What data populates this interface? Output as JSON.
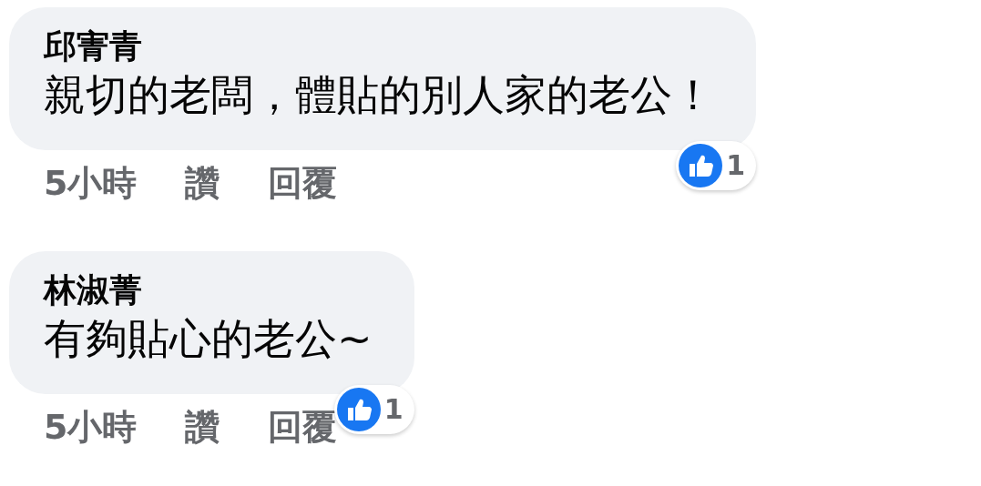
{
  "comments": [
    {
      "author": "邱寈青",
      "text": "親切的老闆，體貼的別人家的老公！",
      "time": "5小時",
      "actions": [
        "讚",
        "回覆"
      ],
      "reaction_count": "1"
    },
    {
      "author": "林淑菁",
      "text": "有夠貼心的老公~",
      "time": "5小時",
      "actions": [
        "讚",
        "回覆"
      ],
      "reaction_count": "1"
    }
  ]
}
